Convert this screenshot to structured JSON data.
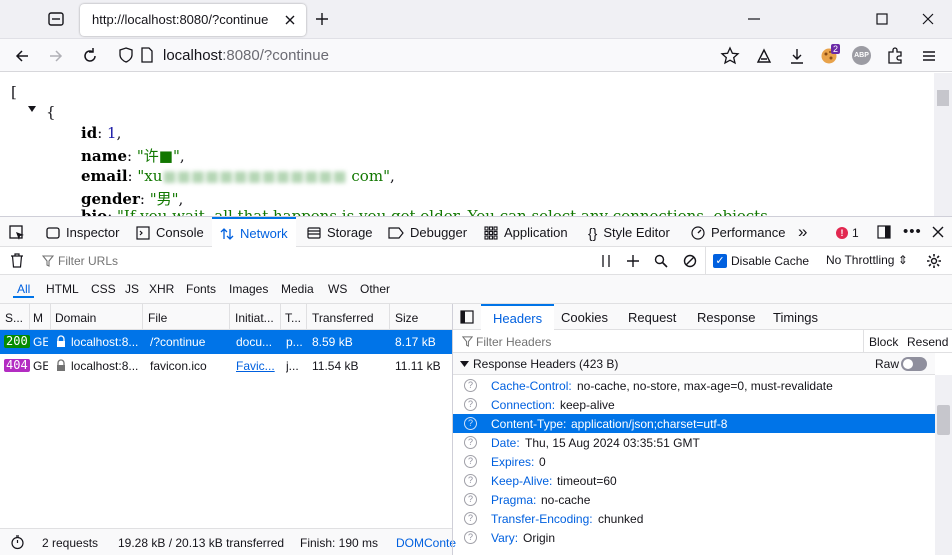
{
  "browser": {
    "tab_title": "http://localhost:8080/?continue",
    "url_host": "localhost",
    "url_rest": ":8080/?continue",
    "extension_badge": "2",
    "abp_label": "ABP"
  },
  "page": {
    "open_bracket": "[",
    "open_brace": "{",
    "fields": [
      {
        "key": "id",
        "value": "1",
        "suffix": ","
      },
      {
        "key": "name",
        "value": "\"许■\"",
        "suffix": ","
      },
      {
        "key": "email",
        "value_prefix": "\"xu",
        "value_blur": "■■■■■■■■■■■■■",
        "value_suffix": " com\"",
        "suffix": ","
      },
      {
        "key": "gender",
        "value": "\"男\"",
        "suffix": ","
      },
      {
        "key": "bio",
        "value": "\"If you wait, all that happens is you get older. You can select any connections, objects",
        "suffix": ""
      }
    ]
  },
  "devtools": {
    "tabs": [
      "Inspector",
      "Console",
      "Network",
      "Storage",
      "Debugger",
      "Application",
      "Style Editor",
      "Performance"
    ],
    "selected_tab": "Network",
    "more_label": "»",
    "error_count": "1",
    "filter_placeholder": "Filter URLs",
    "disable_cache_label": "Disable Cache",
    "throttling_label": "No Throttling ⇕",
    "types": [
      "All",
      "HTML",
      "CSS",
      "JS",
      "XHR",
      "Fonts",
      "Images",
      "Media",
      "WS",
      "Other"
    ],
    "selected_type": "All",
    "columns": [
      "S...",
      "M",
      "Domain",
      "File",
      "Initiat...",
      "T...",
      "Transferred",
      "Size"
    ],
    "requests": [
      {
        "status": "200",
        "method": "GE",
        "domain": "localhost:8...",
        "file": "/?continue",
        "initiator": "docu...",
        "type": "p...",
        "transferred": "8.59 kB",
        "size": "8.17 kB"
      },
      {
        "status": "404",
        "method": "GE",
        "domain": "localhost:8...",
        "file": "favicon.ico",
        "initiator": "Favic...",
        "type": "j...",
        "transferred": "11.54 kB",
        "size": "11.11 kB"
      }
    ],
    "status": {
      "requests": "2 requests",
      "transferred": "19.28 kB / 20.13 kB transferred",
      "finish": "Finish: 190 ms",
      "dom": "DOMConte"
    },
    "detail_tabs": [
      "Headers",
      "Cookies",
      "Request",
      "Response",
      "Timings"
    ],
    "selected_detail_tab": "Headers",
    "filter_headers_placeholder": "Filter Headers",
    "block_label": "Block",
    "resend_label": "Resend",
    "response_headers_title": "Response Headers (423 B)",
    "raw_label": "Raw",
    "headers": [
      {
        "name": "Cache-Control:",
        "value": "no-cache, no-store, max-age=0, must-revalidate"
      },
      {
        "name": "Connection:",
        "value": "keep-alive"
      },
      {
        "name": "Content-Type:",
        "value": "application/json;charset=utf-8"
      },
      {
        "name": "Date:",
        "value": "Thu, 15 Aug 2024 03:35:51 GMT"
      },
      {
        "name": "Expires:",
        "value": "0"
      },
      {
        "name": "Keep-Alive:",
        "value": "timeout=60"
      },
      {
        "name": "Pragma:",
        "value": "no-cache"
      },
      {
        "name": "Transfer-Encoding:",
        "value": "chunked"
      },
      {
        "name": "Vary:",
        "value": "Origin"
      }
    ],
    "selected_header": "Content-Type:"
  }
}
